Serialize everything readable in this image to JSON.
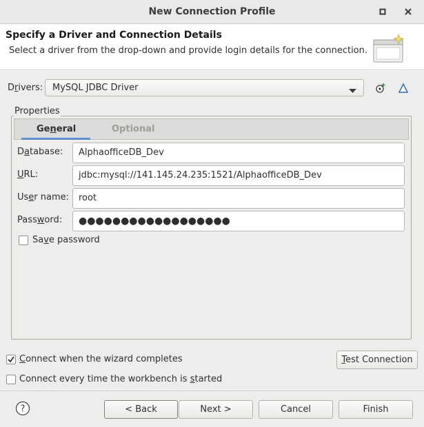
{
  "window": {
    "title": "New Connection Profile"
  },
  "header": {
    "title": "Specify a Driver and Connection Details",
    "description": "Select a driver from the drop-down and provide login details for the connection."
  },
  "drivers": {
    "label_pre": "D",
    "label_u": "r",
    "label_post": "ivers:",
    "selected": "MySQL JDBC Driver"
  },
  "properties": {
    "group_label": "Properties",
    "tabs": [
      {
        "label": "General",
        "underline_char": "n",
        "pre": "Ge",
        "post": "eral",
        "active": true
      },
      {
        "label": "Optional",
        "active": false
      }
    ],
    "fields": {
      "database": {
        "pre": "D",
        "u": "a",
        "post": "tabase:",
        "value": "AlphaofficeDB_Dev"
      },
      "url": {
        "pre": "",
        "u": "U",
        "post": "RL:",
        "value": "jdbc:mysql://141.145.24.235:1521/AlphaofficeDB_Dev"
      },
      "username": {
        "pre": "Us",
        "u": "e",
        "post": "r name:",
        "value": "root"
      },
      "password": {
        "pre": "Pass",
        "u": "w",
        "post": "ord:",
        "value": "●●●●●●●●●●●●●●●●●●"
      }
    },
    "save_password": {
      "pre": "Sa",
      "u": "v",
      "post": "e password",
      "checked": false
    }
  },
  "options": {
    "connect_when_complete": {
      "pre": "",
      "u": "C",
      "post": "onnect when the wizard completes",
      "checked": true
    },
    "connect_every_time": {
      "pre": "Connect every time the workbench is ",
      "u": "s",
      "post": "tarted",
      "checked": false
    }
  },
  "buttons": {
    "test_connection": {
      "pre": "",
      "u": "T",
      "post": "est Connection"
    },
    "back": "< Back",
    "next": "Next >",
    "cancel": "Cancel",
    "finish": "Finish"
  },
  "colors": {
    "accent": "#5e8fd0",
    "background": "#ededec"
  },
  "icons": [
    "minimize-icon",
    "close-icon",
    "wizard-banner-icon",
    "new-driver-icon",
    "edit-driver-icon",
    "dropdown-arrow-icon",
    "checkmark-icon",
    "help-icon"
  ]
}
